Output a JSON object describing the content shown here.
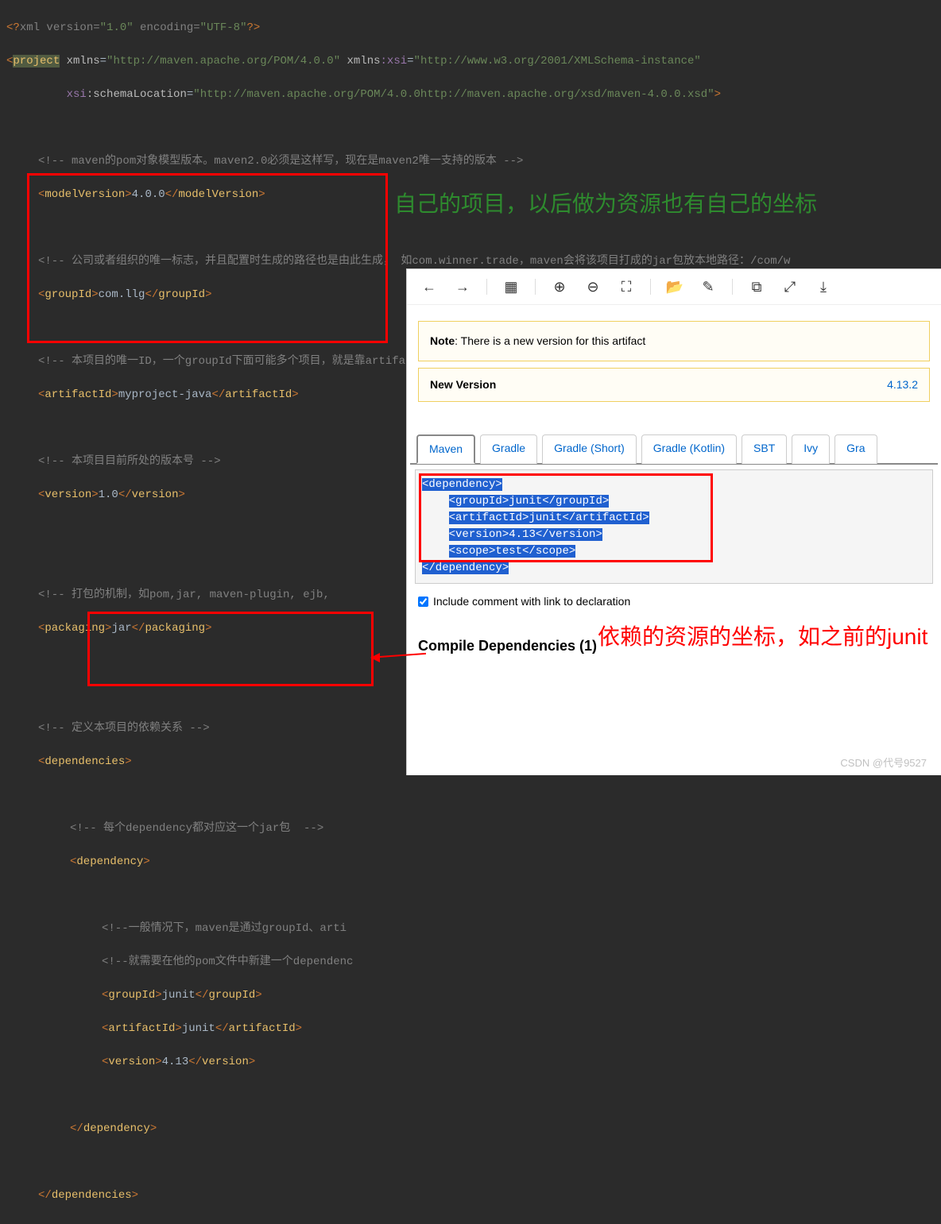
{
  "xml": {
    "decl": "<?xml version=\"1.0\" encoding=\"UTF-8\"?>",
    "project": {
      "tag": "project",
      "xmlns": "http://maven.apache.org/POM/4.0.0",
      "xmlns_xsi": "http://www.w3.org/2001/XMLSchema-instance",
      "schema_loc_attr": "xsi:schemaLocation",
      "schema_loc": "http://maven.apache.org/POM/4.0.0http://maven.apache.org/xsd/maven-4.0.0.xsd"
    },
    "comment_model": "<!-- maven的pom对象模型版本。maven2.0必须是这样写，现在是maven2唯一支持的版本 -->",
    "modelVersion_tag": "modelVersion",
    "modelVersion": "4.0.0",
    "comment_group": "<!-- 公司或者组织的唯一标志，并且配置时生成的路径也是由此生成， 如com.winner.trade，maven会将该项目打成的jar包放本地路径：/com/w",
    "groupId_tag": "groupId",
    "groupId": "com.llg",
    "comment_artifact": "<!-- 本项目的唯一ID，一个groupId下面可能多个项目，就是靠artifactId来区分的 -->",
    "artifactId_tag": "artifactId",
    "artifactId": "myproject-java",
    "comment_version": "<!-- 本项目目前所处的版本号 -->",
    "version_tag": "version",
    "version": "1.0",
    "comment_packaging": "<!-- 打包的机制，如pom,jar, maven-plugin, ejb,",
    "packaging_tag": "packaging",
    "packaging": "jar",
    "comment_deps": "<!-- 定义本项目的依赖关系 -->",
    "dependencies_tag": "dependencies",
    "comment_dep_each": "<!-- 每个dependency都对应这一个jar包  -->",
    "dependency_tag": "dependency",
    "comment_dep_detail1": "<!--一般情况下，maven是通过groupId、arti",
    "comment_dep_detail2": "<!--就需要在他的pom文件中新建一个dependenc",
    "dep_groupId": "junit",
    "dep_artifactId": "junit",
    "dep_version": "4.13"
  },
  "annotations": {
    "green_text": "自己的项目，以后做为资源也有自己的坐标",
    "red_text": "依赖的资源的坐标，如之前的junit"
  },
  "browser": {
    "note_label": "Note",
    "note_text": ": There is a new version for this artifact",
    "new_version_label": "New Version",
    "new_version_value": "4.13.2",
    "tabs": [
      "Maven",
      "Gradle",
      "Gradle (Short)",
      "Gradle (Kotlin)",
      "SBT",
      "Ivy",
      "Gra"
    ],
    "snippet": {
      "line1": "<dependency>",
      "line2_open": "<groupId>",
      "line2_val": "junit",
      "line2_close": "</groupId>",
      "line3_open": "<artifactId>",
      "line3_val": "junit",
      "line3_close": "</artifactId>",
      "line4_open": "<version>",
      "line4_val": "4.13",
      "line4_close": "</version>",
      "line5_open": "<scope>",
      "line5_val": "test",
      "line5_close": "</scope>",
      "line6": "</dependency>"
    },
    "checkbox_label": "Include comment with link to declaration",
    "compile_title": "Compile Dependencies (1)"
  },
  "watermark": "CSDN @代号9527"
}
